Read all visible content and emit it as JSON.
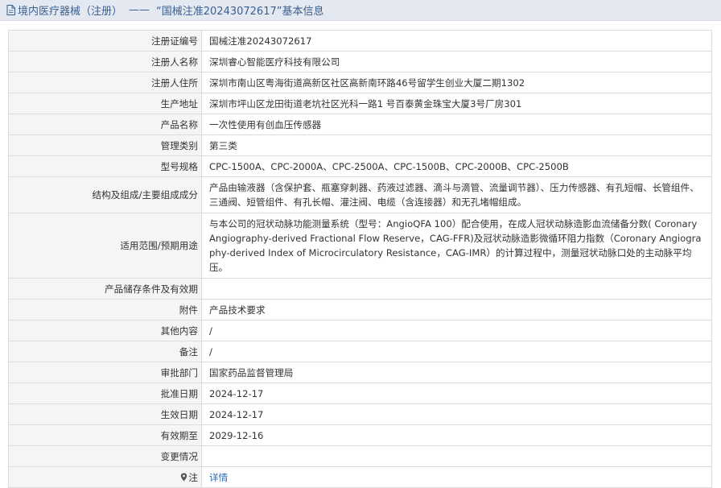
{
  "header": {
    "category": "境内医疗器械（注册）",
    "separator": "——",
    "title": "“国械注准20243072617”基本信息"
  },
  "rows": [
    {
      "label": "注册证编号",
      "value": "国械注准20243072617"
    },
    {
      "label": "注册人名称",
      "value": "深圳睿心智能医疗科技有限公司"
    },
    {
      "label": "注册人住所",
      "value": "深圳市南山区粤海街道高新区社区高新南环路46号留学生创业大厦二期1302"
    },
    {
      "label": "生产地址",
      "value": "深圳市坪山区龙田街道老坑社区光科一路1 号百泰黄金珠宝大厦3号厂房301"
    },
    {
      "label": "产品名称",
      "value": "一次性使用有创血压传感器"
    },
    {
      "label": "管理类别",
      "value": "第三类"
    },
    {
      "label": "型号规格",
      "value": "CPC-1500A、CPC-2000A、CPC-2500A、CPC-1500B、CPC-2000B、CPC-2500B"
    },
    {
      "label": "结构及组成/主要组成成分",
      "value": "产品由输液器（含保护套、瓶塞穿刺器、药液过滤器、滴斗与滴管、流量调节器）、压力传感器、有孔短帽、长管组件、三通阀、短管组件、有孔长帽、灌注阀、电缆（含连接器）和无孔堵帽组成。"
    },
    {
      "label": "适用范围/预期用途",
      "value": "与本公司的冠状动脉功能测量系统（型号：AngioQFA 100）配合使用，在成人冠状动脉造影血流储备分数( Coronary Angiography-derived Fractional Flow Reserve，CAG-FFR)及冠状动脉造影微循环阻力指数（Coronary Angiography-derived Index of Microcirculatory Resistance，CAG-IMR）的计算过程中，测量冠状动脉口处的主动脉平均压。"
    },
    {
      "label": "产品储存条件及有效期",
      "value": ""
    },
    {
      "label": "附件",
      "value": "产品技术要求"
    },
    {
      "label": "其他内容",
      "value": "/"
    },
    {
      "label": "备注",
      "value": "/"
    },
    {
      "label": "审批部门",
      "value": "国家药品监督管理局"
    },
    {
      "label": "批准日期",
      "value": "2024-12-17"
    },
    {
      "label": "生效日期",
      "value": "2024-12-17"
    },
    {
      "label": "有效期至",
      "value": "2029-12-16"
    },
    {
      "label": "变更情况",
      "value": ""
    }
  ],
  "note": {
    "label": "注",
    "link": "详情"
  },
  "colors": {
    "header_bg": "#e4e9f1",
    "header_text": "#3a5f8f",
    "label_bg": "#f5f5f5",
    "border": "#dcdcdc",
    "link": "#2b6cb0"
  },
  "icons": {
    "header": "document-icon",
    "note": "pin-icon"
  }
}
